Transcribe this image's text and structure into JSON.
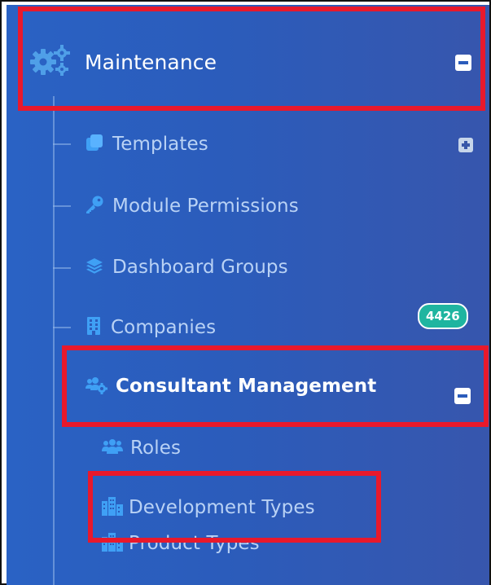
{
  "sidebar": {
    "maintenance": {
      "label": "Maintenance",
      "icon": "cogs-icon",
      "toggle": "collapse-minus"
    },
    "items": [
      {
        "label": "Templates",
        "icon": "copy-icon",
        "toggle": "expand-plus"
      },
      {
        "label": "Module Permissions",
        "icon": "key-icon"
      },
      {
        "label": "Dashboard Groups",
        "icon": "layers-icon"
      },
      {
        "label": "Companies",
        "icon": "building-icon",
        "badge": "4426"
      },
      {
        "label": "Consultant Management",
        "icon": "users-cog-icon",
        "toggle": "collapse-minus"
      }
    ],
    "consultant_children": [
      {
        "label": "Roles",
        "icon": "users-icon"
      },
      {
        "label": "Development Types",
        "icon": "city-icon"
      },
      {
        "label": "Product Types",
        "icon": "city-icon"
      }
    ]
  },
  "colors": {
    "sidebar_bg": "#2b5cbb",
    "highlight": "#e8192c",
    "badge": "#1fb5a0",
    "icon_blue": "#3fa0f5"
  }
}
